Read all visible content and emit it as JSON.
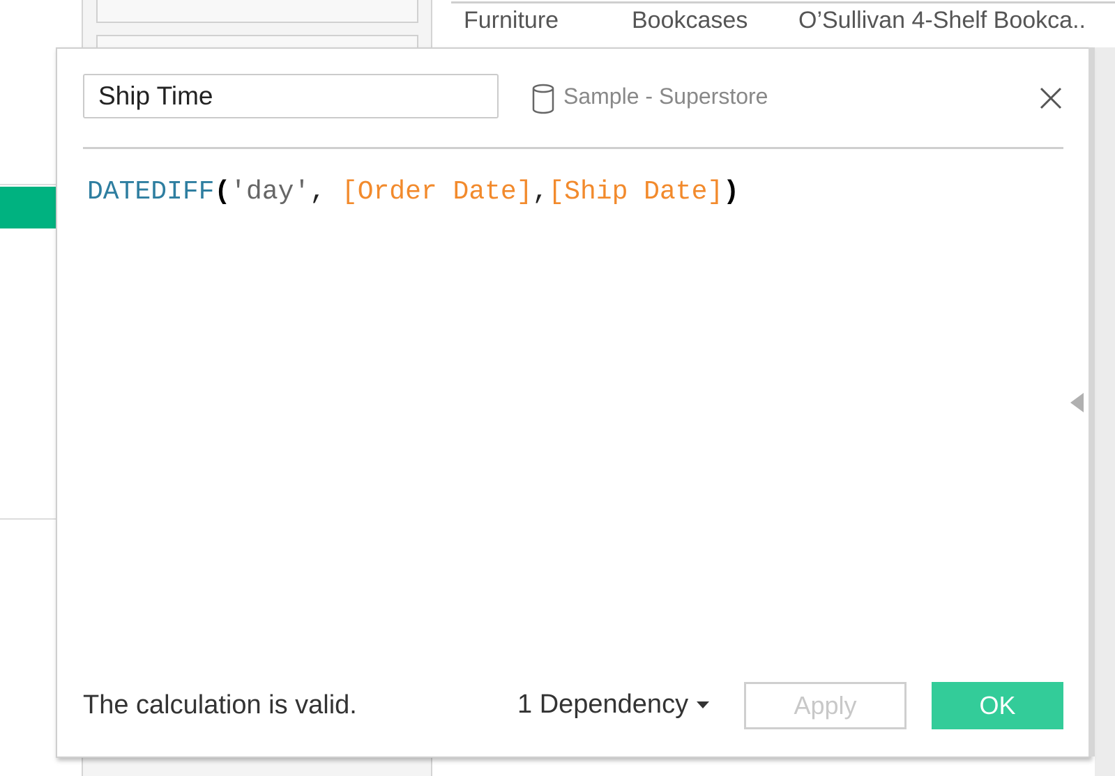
{
  "background": {
    "header_cells": [
      "Furniture",
      "Bookcases",
      "O’Sullivan 4-Shelf Bookca.."
    ]
  },
  "dialog": {
    "calc_name": "Ship Time",
    "data_source": "Sample - Superstore",
    "formula": {
      "function": "DATEDIFF",
      "open_paren": "(",
      "string_arg": "'day'",
      "comma1": ", ",
      "field1": "[Order Date]",
      "comma2": ",",
      "field2": "[Ship Date]",
      "close_paren": ")"
    },
    "status": "The calculation is valid.",
    "dependency_label": "1 Dependency",
    "apply_label": "Apply",
    "ok_label": "OK"
  },
  "colors": {
    "accent": "#33cc99",
    "field": "#f28a2c",
    "function": "#2e7ea0",
    "selection": "#00b280"
  }
}
